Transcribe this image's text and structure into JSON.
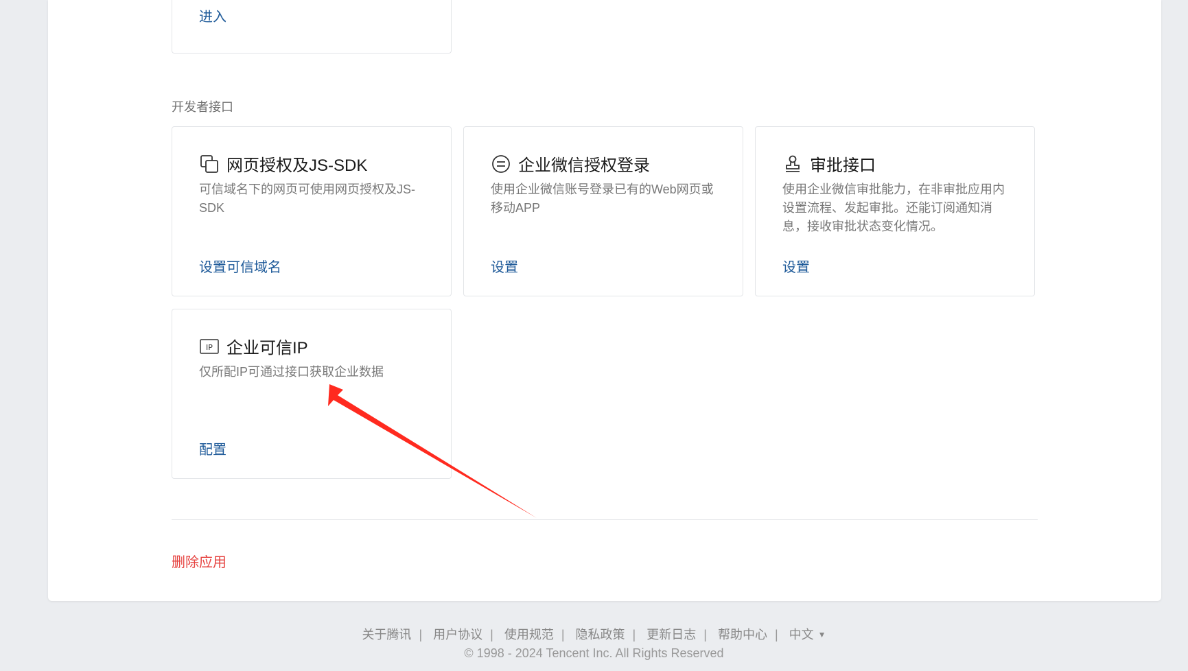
{
  "top_card": {
    "action": "进入"
  },
  "section": {
    "title": "开发者接口"
  },
  "cards": [
    {
      "icon": "copy-icon",
      "title": "网页授权及JS-SDK",
      "desc": "可信域名下的网页可使用网页授权及JS-SDK",
      "action": "设置可信域名"
    },
    {
      "icon": "exchange-icon",
      "title": "企业微信授权登录",
      "desc": "使用企业微信账号登录已有的Web网页或移动APP",
      "action": "设置"
    },
    {
      "icon": "stamp-icon",
      "title": "审批接口",
      "desc": "使用企业微信审批能力，在非审批应用内设置流程、发起审批。还能订阅通知消息，接收审批状态变化情况。",
      "action": "设置"
    },
    {
      "icon": "ip-icon",
      "title": "企业可信IP",
      "desc": "仅所配IP可通过接口获取企业数据",
      "action": "配置"
    }
  ],
  "delete_app": "删除应用",
  "footer": {
    "links": [
      "关于腾讯",
      "用户协议",
      "使用规范",
      "隐私政策",
      "更新日志",
      "帮助中心"
    ],
    "language": "中文",
    "copyright": "© 1998 - 2024 Tencent Inc. All Rights Reserved"
  },
  "colors": {
    "link": "#1e5a99",
    "danger": "#e64340",
    "annotation_arrow": "#ff2a1f"
  }
}
